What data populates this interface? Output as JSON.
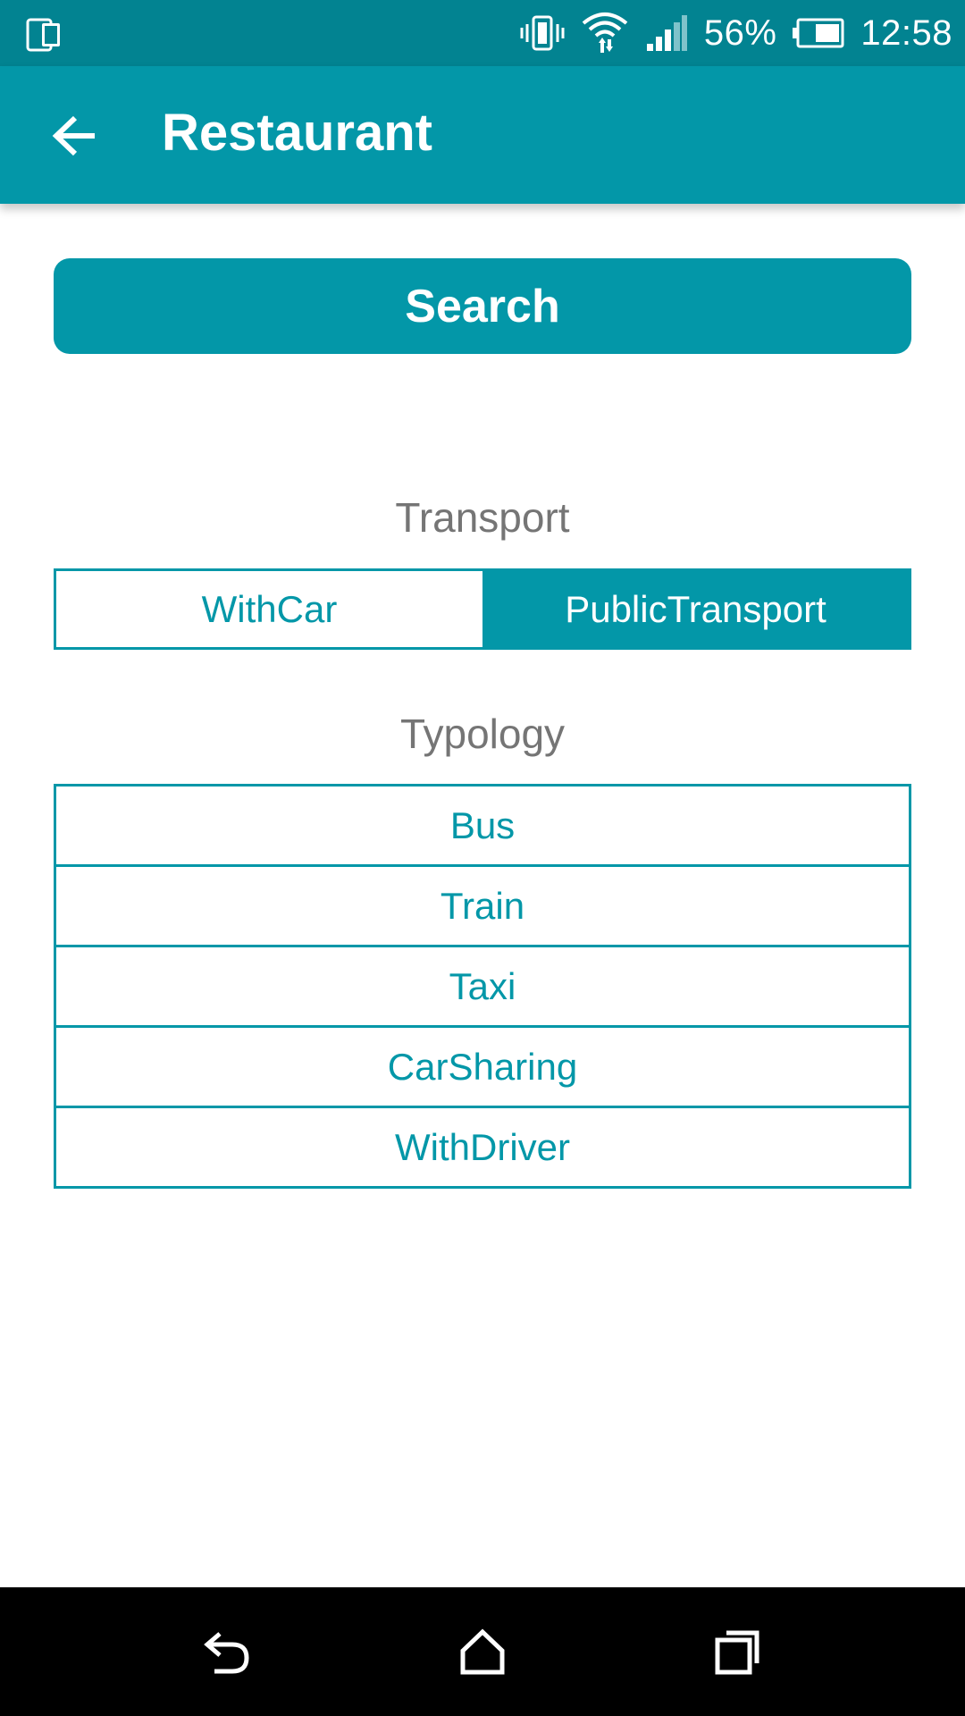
{
  "status_bar": {
    "battery_percent": "56%",
    "time": "12:58",
    "icons": [
      "screen-mirror-icon",
      "vibrate-icon",
      "wifi-icon",
      "signal-icon",
      "battery-icon"
    ]
  },
  "app_bar": {
    "title": "Restaurant",
    "back_icon": "arrow-back-icon"
  },
  "search_button": {
    "label": "Search"
  },
  "transport": {
    "label": "Transport",
    "options": [
      {
        "label": "WithCar",
        "selected": false
      },
      {
        "label": "PublicTransport",
        "selected": true
      }
    ]
  },
  "typology": {
    "label": "Typology",
    "items": [
      {
        "label": "Bus"
      },
      {
        "label": "Train"
      },
      {
        "label": "Taxi"
      },
      {
        "label": "CarSharing"
      },
      {
        "label": "WithDriver"
      }
    ]
  },
  "nav_bar": {
    "icons": [
      "back-icon",
      "home-icon",
      "recents-icon"
    ]
  },
  "colors": {
    "status_bar": "#028391",
    "primary": "#0397a8",
    "label_gray": "#757575",
    "nav_bar": "#000000"
  }
}
